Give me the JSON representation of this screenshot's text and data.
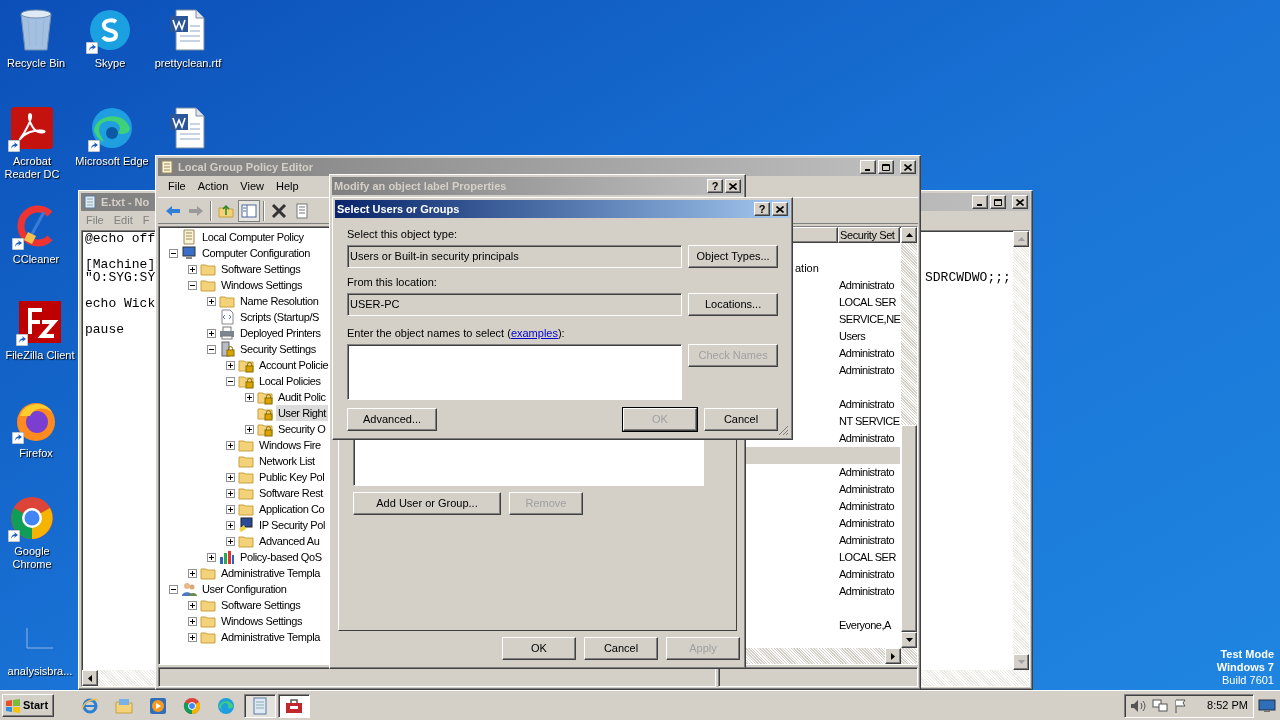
{
  "desktop": {
    "icons": [
      {
        "label": "Recycle Bin",
        "kind": "recycle-bin",
        "shortcut": false
      },
      {
        "label": "Skype",
        "kind": "skype",
        "shortcut": true
      },
      {
        "label": "prettyclean.rtf",
        "kind": "word-doc",
        "shortcut": false
      },
      {
        "label": "Acrobat Reader DC",
        "kind": "acrobat",
        "shortcut": true
      },
      {
        "label": "Microsoft Edge",
        "kind": "edge",
        "shortcut": true
      },
      {
        "kind": "word-doc",
        "shortcut": false
      },
      {
        "label": "CCleaner",
        "kind": "ccleaner",
        "shortcut": true
      },
      {
        "label": "FileZilla Client",
        "kind": "filezilla",
        "shortcut": true
      },
      {
        "label": "Firefox",
        "kind": "firefox",
        "shortcut": true
      },
      {
        "label": "Google Chrome",
        "kind": "chrome",
        "shortcut": true
      },
      {
        "label": "analysisbra...",
        "kind": "blank",
        "shortcut": false
      }
    ],
    "os_notice": [
      "Test Mode",
      "Windows 7",
      "Build 7601"
    ]
  },
  "notepad": {
    "title": "E.txt - No",
    "menu": [
      "File",
      "Edit",
      "F"
    ],
    "groups": [
      {
        "lines": [
          {
            "text": "@echo off"
          }
        ]
      },
      {
        "lines": [
          {
            "text": "[Machine]"
          },
          {
            "text": "\"O:SYG:SY",
            "continuation": "SDRCWDWO;;;"
          }
        ]
      },
      {
        "lines": [
          {
            "text": "echo Wick"
          }
        ]
      },
      {
        "lines": [
          {
            "text": "pause"
          }
        ]
      }
    ]
  },
  "gpe": {
    "title": "Local Group Policy Editor",
    "menu": [
      "File",
      "Action",
      "View",
      "Help"
    ],
    "tree": [
      {
        "label": "Local Computer Policy",
        "kind": "policy",
        "selected": false,
        "children": [
          {
            "label": "Computer Configuration",
            "kind": "computer",
            "selected": false,
            "expanded": true,
            "children": [
              {
                "label": "Software Settings",
                "kind": "folder",
                "selected": false,
                "expanded": false
              },
              {
                "label": "Windows Settings",
                "kind": "folder",
                "selected": false,
                "expanded": true,
                "children": [
                  {
                    "label": "Name Resolution",
                    "kind": "folder",
                    "selected": false,
                    "expanded": false
                  },
                  {
                    "label": "Scripts (Startup/S",
                    "kind": "script",
                    "selected": false
                  },
                  {
                    "label": "Deployed Printers",
                    "kind": "printer",
                    "selected": false,
                    "expanded": false
                  },
                  {
                    "label": "Security Settings",
                    "kind": "server-lock",
                    "selected": false,
                    "expanded": true,
                    "children": [
                      {
                        "label": "Account Policie",
                        "kind": "lock-folder",
                        "selected": false,
                        "expanded": false
                      },
                      {
                        "label": "Local Policies",
                        "kind": "lock-folder",
                        "selected": false,
                        "expanded": true,
                        "children": [
                          {
                            "label": "Audit Polic",
                            "kind": "lock-folder",
                            "selected": false,
                            "expanded": false
                          },
                          {
                            "label": "User Right",
                            "kind": "lock-folder",
                            "selected": true
                          },
                          {
                            "label": "Security O",
                            "kind": "lock-folder",
                            "selected": false,
                            "expanded": false
                          }
                        ]
                      },
                      {
                        "label": "Windows Fire",
                        "kind": "folder",
                        "selected": false,
                        "expanded": false
                      },
                      {
                        "label": "Network List",
                        "kind": "folder",
                        "selected": false
                      },
                      {
                        "label": "Public Key Pol",
                        "kind": "folder",
                        "selected": false,
                        "expanded": false
                      },
                      {
                        "label": "Software Rest",
                        "kind": "folder",
                        "selected": false,
                        "expanded": false
                      },
                      {
                        "label": "Application Co",
                        "kind": "folder",
                        "selected": false,
                        "expanded": false
                      },
                      {
                        "label": "IP Security Pol",
                        "kind": "network-lock",
                        "selected": false,
                        "expanded": false
                      },
                      {
                        "label": "Advanced Au",
                        "kind": "folder",
                        "selected": false,
                        "expanded": false
                      }
                    ]
                  },
                  {
                    "label": "Policy-based QoS",
                    "kind": "chart",
                    "selected": false,
                    "expanded": false
                  }
                ]
              },
              {
                "label": "Administrative Templa",
                "kind": "folder",
                "selected": false,
                "expanded": false
              }
            ]
          },
          {
            "label": "User Configuration",
            "kind": "user",
            "selected": false,
            "expanded": true,
            "children": [
              {
                "label": "Software Settings",
                "kind": "folder",
                "selected": false,
                "expanded": false
              },
              {
                "label": "Windows Settings",
                "kind": "folder",
                "selected": false,
                "expanded": false
              },
              {
                "label": "Administrative Templa",
                "kind": "folder",
                "selected": false,
                "expanded": false
              }
            ]
          }
        ]
      }
    ],
    "column_header": "Security Set",
    "rows": [
      {
        "selected": false
      },
      {
        "column_1": "ation",
        "selected": false
      },
      {
        "column_2": "Administrato",
        "selected": false
      },
      {
        "column_2": "LOCAL SER",
        "selected": false
      },
      {
        "column_2": "SERVICE,NE",
        "selected": false
      },
      {
        "column_2": "Users",
        "selected": false
      },
      {
        "column_2": "Administrato",
        "selected": false
      },
      {
        "column_2": "Administrato",
        "selected": false
      },
      {
        "selected": false
      },
      {
        "column_2": "Administrato",
        "selected": false
      },
      {
        "column_2": "NT SERVICE",
        "selected": false
      },
      {
        "column_2": "Administrato",
        "selected": false
      },
      {
        "selected": true
      },
      {
        "column_2": "Administrato",
        "selected": false
      },
      {
        "column_2": "Administrato",
        "selected": false
      },
      {
        "column_2": "Administrato",
        "selected": false
      },
      {
        "column_2": "Administrato",
        "selected": false
      },
      {
        "column_2": "Administrato",
        "selected": false
      },
      {
        "column_2": "LOCAL SER",
        "selected": false
      },
      {
        "column_2": "Administrato",
        "selected": false
      },
      {
        "column_2": "Administrato",
        "selected": false
      },
      {
        "selected": false
      },
      {
        "column_2": "Everyone,A",
        "selected": false
      }
    ]
  },
  "properties_dialog": {
    "title": "Modify an object label Properties",
    "help": "?",
    "list_buttons": [
      {
        "label": "Add User or Group...",
        "disabled": false
      },
      {
        "label": "Remove",
        "disabled": true
      }
    ],
    "buttons": [
      {
        "label": "OK",
        "disabled": false
      },
      {
        "label": "Cancel",
        "disabled": false
      },
      {
        "label": "Apply",
        "disabled": true
      }
    ]
  },
  "select_dialog": {
    "title": "Select Users or Groups",
    "help": "?",
    "object_type_label": "Select this object type:",
    "object_type": "Users or Built-in security principals",
    "object_types_button": {
      "label": "Object Types...",
      "disabled": false
    },
    "location_label": "From this location:",
    "location": "USER-PC",
    "locations_button": {
      "label": "Locations...",
      "disabled": false
    },
    "names_label": {
      "before": "Enter the object names to select (",
      "link": "examples",
      "after": "):"
    },
    "check_names_button": {
      "label": "Check Names",
      "disabled": true
    },
    "advanced_button": {
      "label": "Advanced...",
      "disabled": false
    },
    "buttons": [
      {
        "label": "OK",
        "disabled": true
      },
      {
        "label": "Cancel",
        "disabled": false
      }
    ]
  },
  "taskbar": {
    "start": "Start",
    "items": [
      {
        "kind": "ie",
        "open": false,
        "selected": false
      },
      {
        "kind": "explorer",
        "open": false,
        "selected": false
      },
      {
        "kind": "media",
        "open": false,
        "selected": false
      },
      {
        "kind": "chrome",
        "open": false,
        "selected": false
      },
      {
        "kind": "edge",
        "open": false,
        "selected": false
      },
      {
        "kind": "notepad",
        "open": true,
        "selected": false
      },
      {
        "kind": "gpedit",
        "open": true,
        "selected": true
      }
    ],
    "clock": "8:52 PM"
  }
}
